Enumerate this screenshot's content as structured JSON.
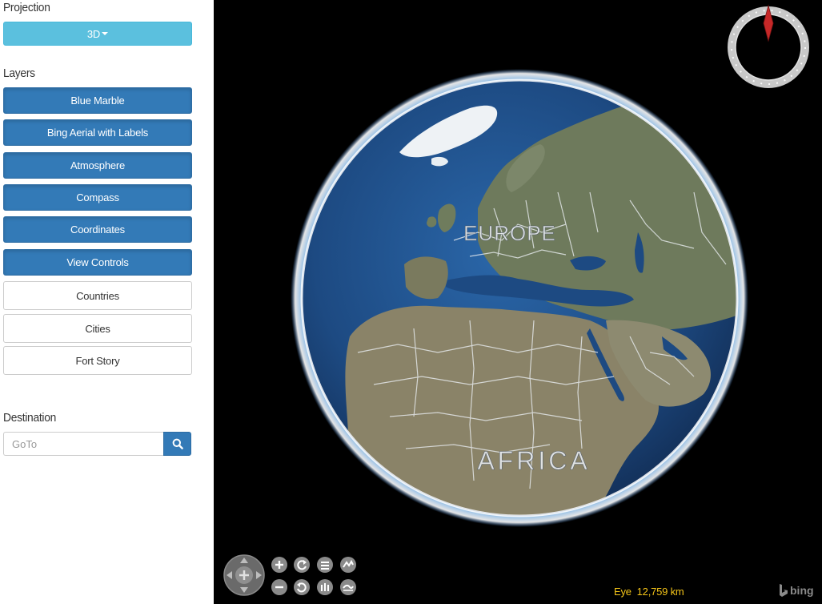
{
  "sidebar": {
    "projection_title": "Projection",
    "projection_value": "3D",
    "layers_title": "Layers",
    "layers": [
      {
        "label": "Blue Marble",
        "active": true
      },
      {
        "label": "Bing Aerial with Labels",
        "active": true
      },
      {
        "label": "Atmosphere",
        "active": true
      },
      {
        "label": "Compass",
        "active": true
      },
      {
        "label": "Coordinates",
        "active": true
      },
      {
        "label": "View Controls",
        "active": true
      },
      {
        "label": "Countries",
        "active": false
      },
      {
        "label": "Cities",
        "active": false
      },
      {
        "label": "Fort Story",
        "active": false
      }
    ],
    "destination_title": "Destination",
    "goto_placeholder": "GoTo",
    "goto_value": "",
    "search_icon": "search-icon"
  },
  "globe": {
    "labels": {
      "europe": "EUROPE",
      "africa": "AFRICA"
    },
    "eye_label": "Eye",
    "eye_value": "12,759 km",
    "bing_logo_text": "bing",
    "compass_icon": "compass-icon",
    "controls": {
      "pan": "pan-control-icon",
      "zoom_in": "zoom-in-icon",
      "zoom_out": "zoom-out-icon",
      "rotate_ccw": "rotate-ccw-icon",
      "rotate_cw": "rotate-cw-icon",
      "tilt_up": "tilt-up-icon",
      "tilt_down": "tilt-down-icon",
      "exaggeration_up": "exaggeration-up-icon",
      "exaggeration_down": "exaggeration-down-icon"
    }
  },
  "colors": {
    "projection_button": "#5bc0de",
    "active_layer": "#337ab7",
    "eye_text": "#f3c318",
    "globe_ocean": "#1f4f8a",
    "compass_needle": "#c62828"
  }
}
